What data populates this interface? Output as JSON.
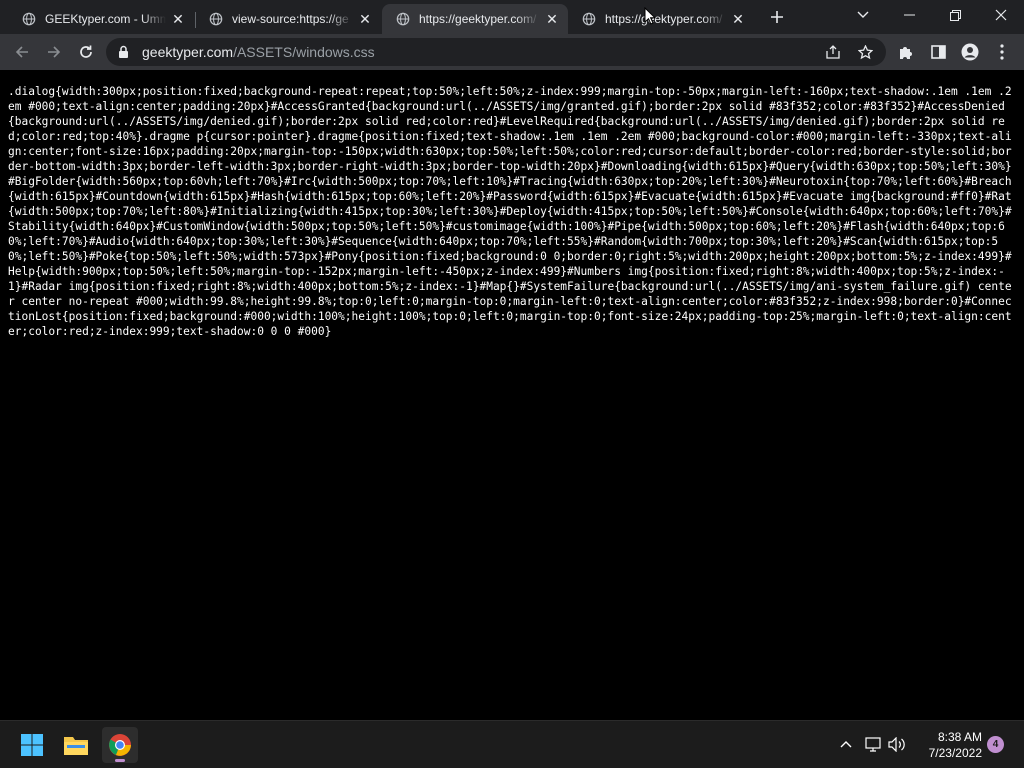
{
  "browser": {
    "tabs": [
      {
        "title": "GEEKtyper.com - Umm",
        "active": false
      },
      {
        "title": "view-source:https://ge",
        "active": false
      },
      {
        "title": "https://geektyper.com/",
        "active": true
      },
      {
        "title": "https://geektyper.com/",
        "active": false
      }
    ],
    "address": {
      "host": "geektyper.com",
      "path": "/ASSETS/windows.css"
    }
  },
  "page": {
    "source_text": ".dialog{width:300px;position:fixed;background-repeat:repeat;top:50%;left:50%;z-index:999;margin-top:-50px;margin-left:-160px;text-shadow:.1em .1em .2em #000;text-align:center;padding:20px}#AccessGranted{background:url(../ASSETS/img/granted.gif);border:2px solid #83f352;color:#83f352}#AccessDenied{background:url(../ASSETS/img/denied.gif);border:2px solid red;color:red}#LevelRequired{background:url(../ASSETS/img/denied.gif);border:2px solid red;color:red;top:40%}.dragme p{cursor:pointer}.dragme{position:fixed;text-shadow:.1em .1em .2em #000;background-color:#000;margin-left:-330px;text-align:center;font-size:16px;padding:20px;margin-top:-150px;width:630px;top:50%;left:50%;color:red;cursor:default;border-color:red;border-style:solid;border-bottom-width:3px;border-left-width:3px;border-right-width:3px;border-top-width:20px}#Downloading{width:615px}#Query{width:630px;top:50%;left:30%}#BigFolder{width:560px;top:60vh;left:70%}#Irc{width:500px;top:70%;left:10%}#Tracing{width:630px;top:20%;left:30%}#Neurotoxin{top:70%;left:60%}#Breach{width:615px}#Countdown{width:615px}#Hash{width:615px;top:60%;left:20%}#Password{width:615px}#Evacuate{width:615px}#Evacuate img{background:#ff0}#Rat{width:500px;top:70%;left:80%}#Initializing{width:415px;top:30%;left:30%}#Deploy{width:415px;top:50%;left:50%}#Console{width:640px;top:60%;left:70%}#Stability{width:640px}#CustomWindow{width:500px;top:50%;left:50%}#customimage{width:100%}#Pipe{width:500px;top:60%;left:20%}#Flash{width:640px;top:60%;left:70%}#Audio{width:640px;top:30%;left:30%}#Sequence{width:640px;top:70%;left:55%}#Random{width:700px;top:30%;left:20%}#Scan{width:615px;top:50%;left:50%}#Poke{top:50%;left:50%;width:573px}#Pony{position:fixed;background:0 0;border:0;right:5%;width:200px;height:200px;bottom:5%;z-index:499}#Help{width:900px;top:50%;left:50%;margin-top:-152px;margin-left:-450px;z-index:499}#Numbers img{position:fixed;right:8%;width:400px;top:5%;z-index:-1}#Radar img{position:fixed;right:8%;width:400px;bottom:5%;z-index:-1}#Map{}#SystemFailure{background:url(../ASSETS/img/ani-system_failure.gif) center center no-repeat #000;width:99.8%;height:99.8%;top:0;left:0;margin-top:0;margin-left:0;text-align:center;color:#83f352;z-index:998;border:0}#ConnectionLost{position:fixed;background:#000;width:100%;height:100%;top:0;left:0;margin-top:0;font-size:24px;padding-top:25%;margin-left:0;text-align:center;color:red;z-index:999;text-shadow:0 0 0 #000}"
  },
  "taskbar": {
    "time": "8:38 AM",
    "date": "7/23/2022",
    "notification_count": "4"
  },
  "colors": {
    "tabstrip": "#202124",
    "toolbar": "#35363a",
    "page_bg": "#000000",
    "text": "#ffffff",
    "taskbar": "#1c1c1c",
    "accent": "#c08fd0"
  }
}
